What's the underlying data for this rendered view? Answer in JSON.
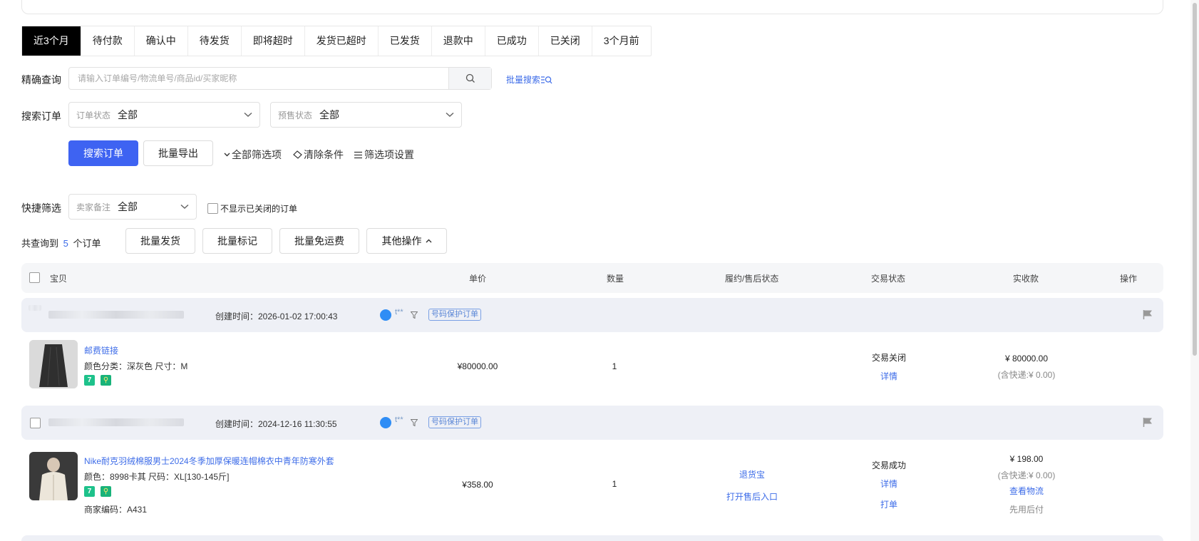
{
  "tabs": [
    "近3个月",
    "待付款",
    "确认中",
    "待发货",
    "即将超时",
    "发货已超时",
    "已发货",
    "退款中",
    "已成功",
    "已关闭",
    "3个月前"
  ],
  "precise_search": {
    "label": "精确查询",
    "placeholder": "请输入订单编号/物流单号/商品id/买家昵称",
    "batch_search_link": "批量搜索"
  },
  "search_order": {
    "label": "搜索订单",
    "order_status_label": "订单状态",
    "order_status_value": "全部",
    "presale_status_label": "预售状态",
    "presale_status_value": "全部"
  },
  "actions": {
    "search_button": "搜索订单",
    "export_button": "批量导出",
    "all_filters": "全部筛选项",
    "clear_conditions": "清除条件",
    "filter_settings": "筛选项设置"
  },
  "quick_filter": {
    "label": "快捷筛选",
    "seller_note_label": "卖家备注",
    "seller_note_value": "全部",
    "hide_closed_label": "不显示已关闭的订单"
  },
  "summary": {
    "prefix": "共查询到",
    "count": "5",
    "suffix": "个订单",
    "batch_ship": "批量发货",
    "batch_mark": "批量标记",
    "batch_free_shipping": "批量免运费",
    "other_ops": "其他操作"
  },
  "table_headers": {
    "item": "宝贝",
    "unit_price": "单价",
    "quantity": "数量",
    "fulfillment": "履约/售后状态",
    "trade_status": "交易状态",
    "received": "实收款",
    "operation": "操作"
  },
  "orders": [
    {
      "create_time": "创建时间：2026-01-02 17:00:43",
      "buyer": "t**",
      "protect_badge": "号码保护订单",
      "product_title": "邮费链接",
      "attr_line": "颜色分类：深灰色  尺寸：M",
      "unit_price": "¥80000.00",
      "quantity": "1",
      "trade_status": "交易关闭",
      "detail_link": "详情",
      "received": "¥ 80000.00",
      "shipping_incl": "(含快递:¥ 0.00)"
    },
    {
      "create_time": "创建时间：2024-12-16 11:30:55",
      "buyer": "t**",
      "protect_badge": "号码保护订单",
      "product_title": "Nike耐克羽绒棉服男士2024冬季加厚保暖连帽棉衣中青年防寒外套",
      "attr_line": "颜色：8998卡其  尺码：XL[130-145斤]",
      "merchant_code": "商家编码：A431",
      "unit_price": "¥358.00",
      "quantity": "1",
      "fulfillment_1": "退货宝",
      "fulfillment_2": "打开售后入口",
      "trade_status": "交易成功",
      "detail_link": "详情",
      "print_link": "打单",
      "received": "¥ 198.00",
      "shipping_incl": "(含快递:¥ 0.00)",
      "logistics_link": "查看物流",
      "pay_later": "先用后付"
    }
  ],
  "colors": {
    "primary": "#3e63f2",
    "link": "#3d6ce8",
    "active_tab_bg": "#000000",
    "order_head_bg": "#eef0f6"
  }
}
